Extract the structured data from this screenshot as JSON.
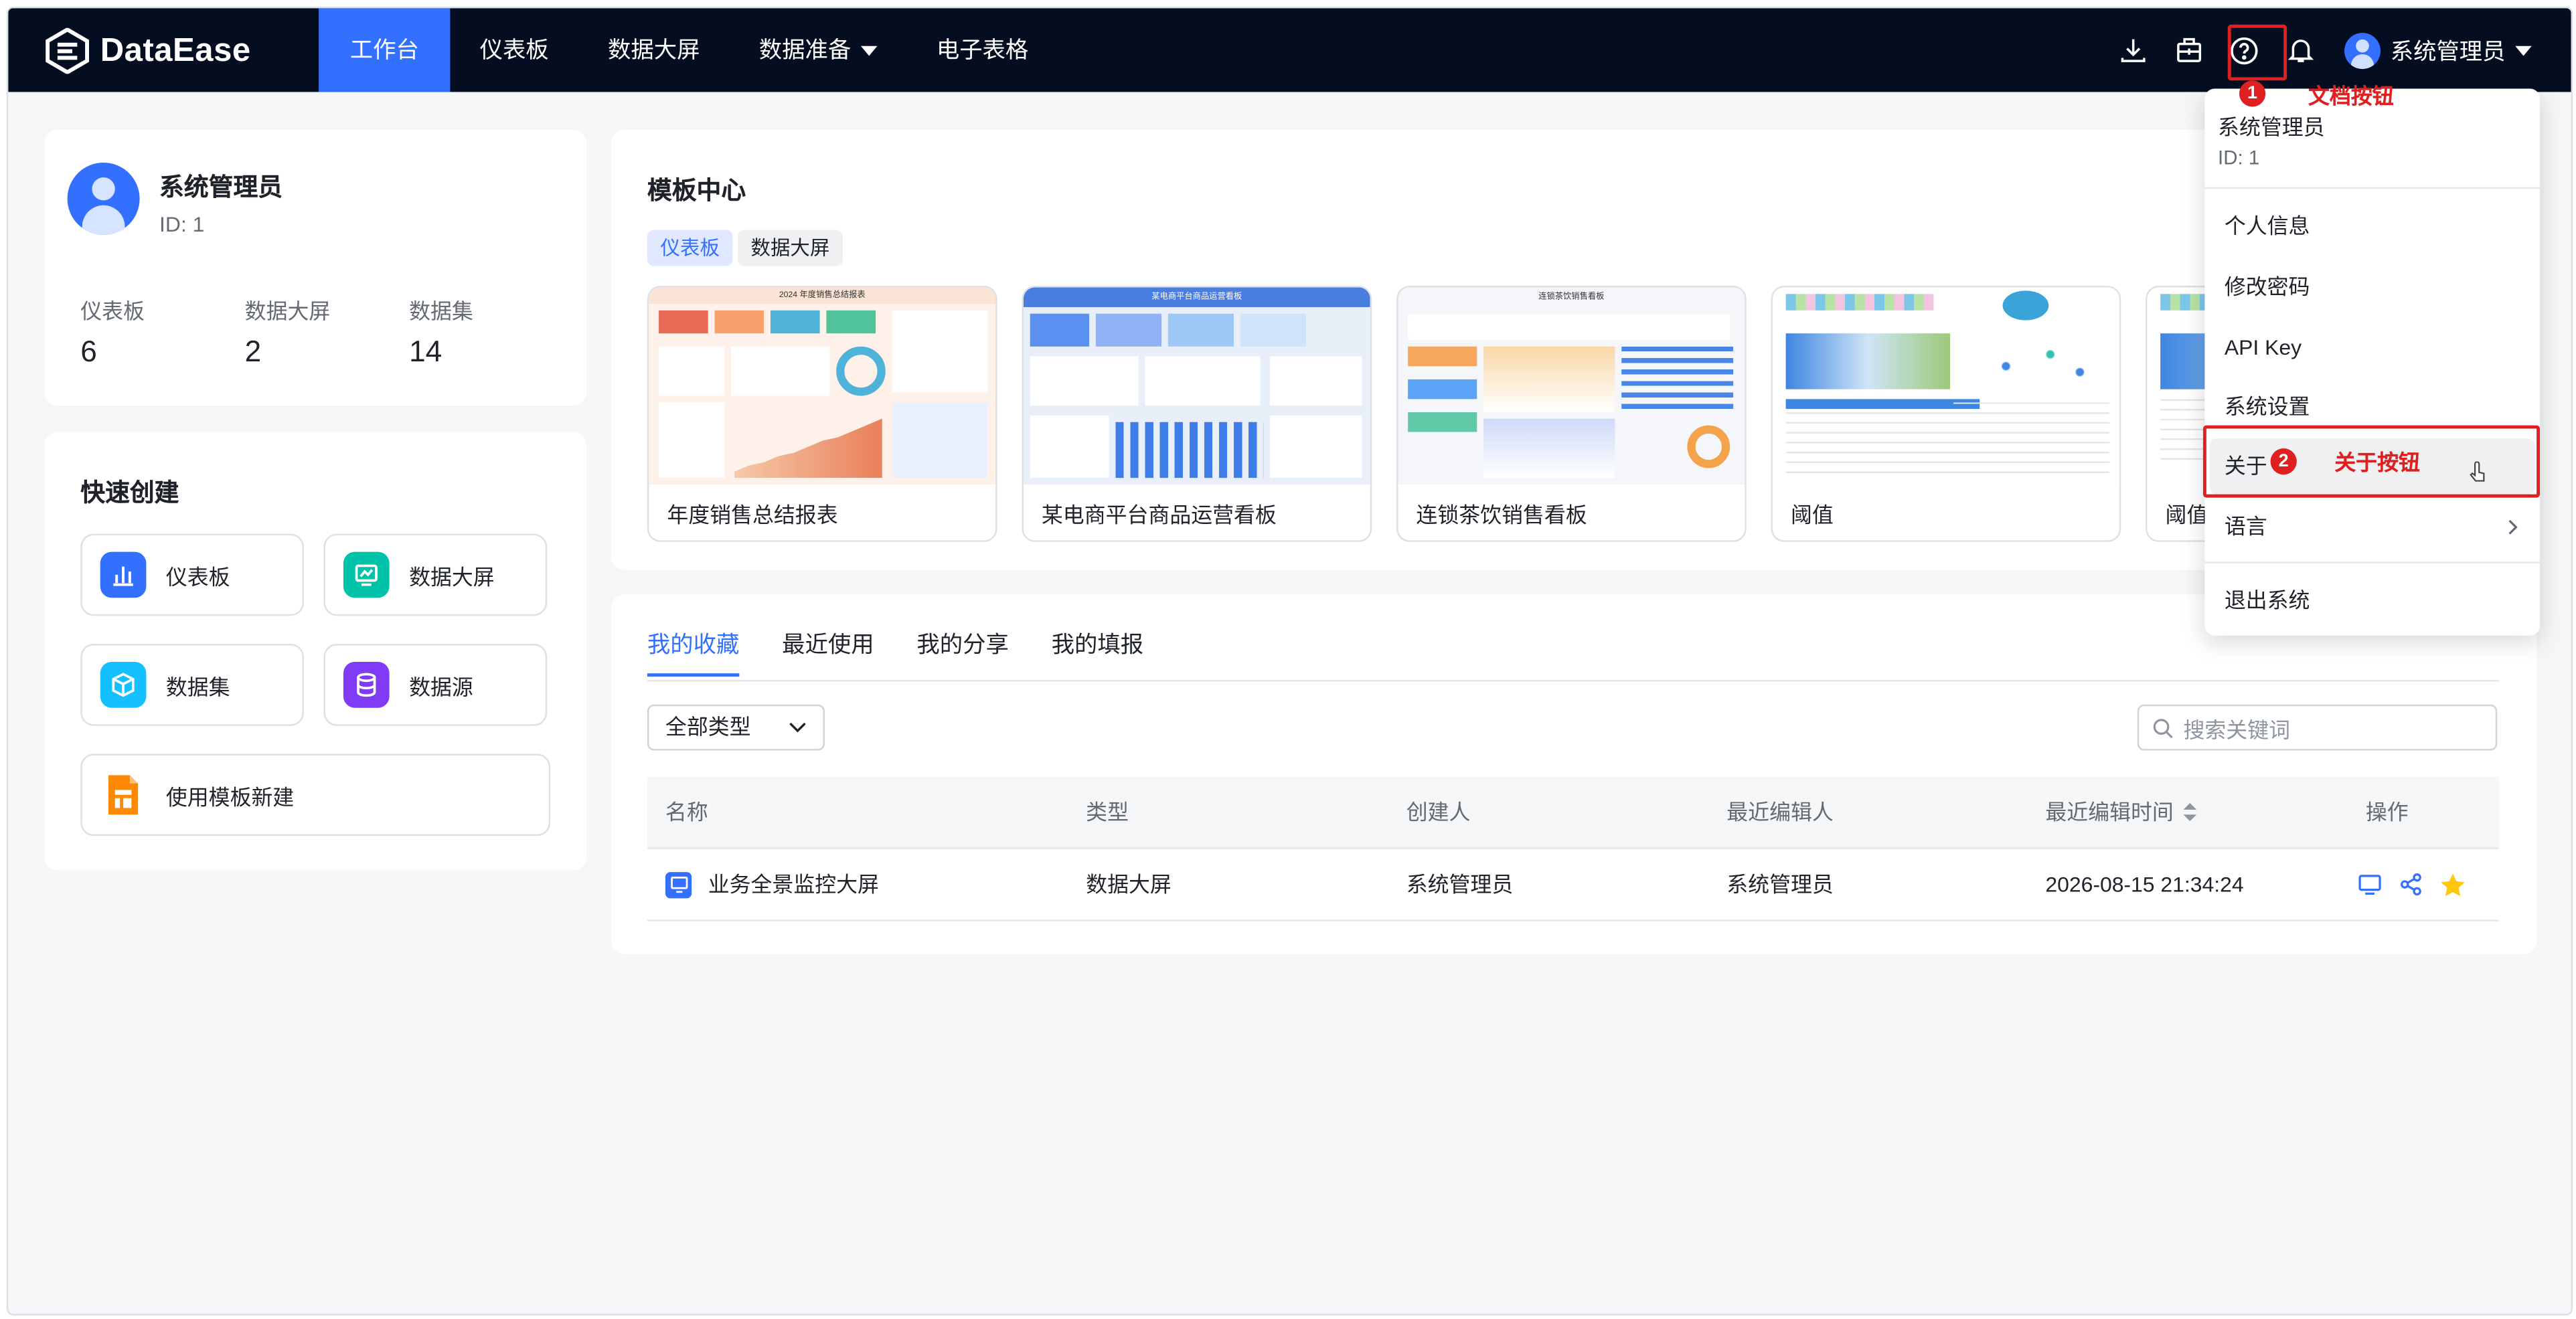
{
  "app": {
    "logo_text": "DataEase"
  },
  "nav": [
    {
      "label": "工作台",
      "active": true
    },
    {
      "label": "仪表板"
    },
    {
      "label": "数据大屏"
    },
    {
      "label": "数据准备",
      "has_dropdown": true
    },
    {
      "label": "电子表格"
    }
  ],
  "header": {
    "icons": [
      "download-icon",
      "toolbox-icon",
      "help-icon",
      "bell-icon"
    ],
    "user_name": "系统管理员"
  },
  "annotations": {
    "doc_marker": "1",
    "doc_label": "文档按钮",
    "about_marker": "2",
    "about_label": "关于按钮",
    "color": "#e02020"
  },
  "profile": {
    "name": "系统管理员",
    "id_text": "ID: 1",
    "stats": [
      {
        "label": "仪表板",
        "value": "6"
      },
      {
        "label": "数据大屏",
        "value": "2"
      },
      {
        "label": "数据集",
        "value": "14"
      }
    ]
  },
  "quick_create": {
    "title": "快速创建",
    "buttons": [
      {
        "label": "仪表板",
        "icon": "bar-chart-icon",
        "color": "#3370ff"
      },
      {
        "label": "数据大屏",
        "icon": "screen-icon",
        "color": "#00c2a8"
      },
      {
        "label": "数据集",
        "icon": "cube-icon",
        "color": "#14c0ff"
      },
      {
        "label": "数据源",
        "icon": "database-icon",
        "color": "#7f3bf5"
      },
      {
        "label": "使用模板新建",
        "icon": "template-icon",
        "color": "#ff8800"
      }
    ]
  },
  "templates": {
    "title": "模板中心",
    "chips": [
      {
        "label": "仪表板",
        "active": true
      },
      {
        "label": "数据大屏"
      }
    ],
    "cards": [
      {
        "name": "年度销售总结报表",
        "thumb_title": "2024 年度销售总结报表"
      },
      {
        "name": "某电商平台商品运营看板",
        "thumb_title": "某电商平台商品运营看板"
      },
      {
        "name": "连锁茶饮销售看板",
        "thumb_title": "连锁茶饮销售看板"
      },
      {
        "name": "阈值",
        "thumb_title": ""
      },
      {
        "name": "阈值",
        "thumb_title": ""
      }
    ]
  },
  "favorites": {
    "tabs": [
      {
        "label": "我的收藏",
        "active": true
      },
      {
        "label": "最近使用"
      },
      {
        "label": "我的分享"
      },
      {
        "label": "我的填报"
      }
    ],
    "type_filter": "全部类型",
    "search_placeholder": "搜索关键词",
    "columns": [
      "名称",
      "类型",
      "创建人",
      "最近编辑人",
      "最近编辑时间",
      "操作"
    ],
    "rows": [
      {
        "name": "业务全景监控大屏",
        "type": "数据大屏",
        "creator": "系统管理员",
        "editor": "系统管理员",
        "time": "2026-08-15 21:34:24"
      }
    ]
  },
  "user_menu": {
    "name": "系统管理员",
    "id_text": "ID: 1",
    "items": [
      "个人信息",
      "修改密码",
      "API Key",
      "系统设置",
      "关于",
      "语言",
      "退出系统"
    ]
  },
  "colors": {
    "primary": "#3370ff",
    "topbar": "#050e21",
    "star": "#ffc60a"
  }
}
